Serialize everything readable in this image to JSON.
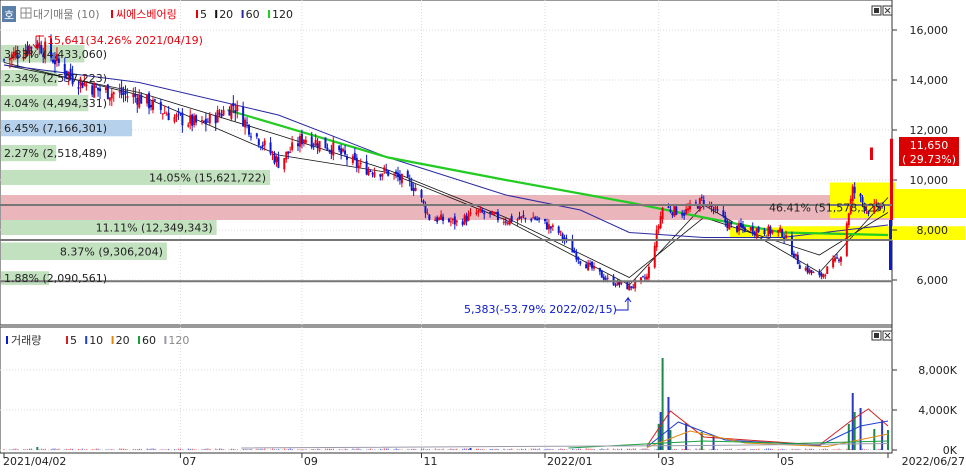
{
  "colors": {
    "up": "#e8000c",
    "down": "#0a1acc",
    "ma5": "#111111",
    "ma20": "#111111",
    "ma60": "#2a2aa0",
    "ma120": "#22cc22",
    "vol5": "#d22020",
    "vol10": "#2040d0",
    "vol20": "#e08a10",
    "vol60": "#18a040",
    "vol120": "#9a9aa8",
    "price_box": "#d80000",
    "highlight": "#ffff00",
    "band_pink": "#e7a8b0",
    "band_green": "#b7ddb4",
    "band_blue": "#a9c9e8"
  },
  "header": {
    "icon": "grid-icon",
    "label_stock_type": "대기매물",
    "label_stock_type_count": "(10)",
    "stock_name": "씨에스베어링",
    "ma_legend": [
      {
        "label": "5",
        "color": "#e8000c"
      },
      {
        "label": "20",
        "color": "#111111"
      },
      {
        "label": "60",
        "color": "#2a2aa0"
      },
      {
        "label": "120",
        "color": "#22cc22"
      }
    ],
    "window_buttons": [
      "restore-icon",
      "close-icon"
    ]
  },
  "side_tab": "호",
  "volume_header": {
    "title": "거래량",
    "legend": [
      {
        "label": "5",
        "color": "#d22020"
      },
      {
        "label": "10",
        "color": "#2040d0"
      },
      {
        "label": "20",
        "color": "#e08a10"
      },
      {
        "label": "60",
        "color": "#18a040"
      },
      {
        "label": "120",
        "color": "#9a9aa8"
      }
    ]
  },
  "annotations": {
    "high": "15,641(34.26% 2021/04/19)",
    "low": "5,383(-53.79% 2022/02/15)",
    "current_price": "11,650",
    "current_change": "( 29.73%)"
  },
  "chart_data": [
    {
      "type": "candlestick",
      "title": "씨에스베어링",
      "x_start": "2021/04/02",
      "x_end": "2022/06/27",
      "x_ticks": [
        "2021/04/02",
        "07",
        "09",
        "11",
        "2022/01",
        "03",
        "05",
        "2022/06/27"
      ],
      "y_ticks": [
        6000,
        8000,
        10000,
        12000,
        14000,
        16000
      ],
      "y_tick_labels": [
        "6,000",
        "8,000",
        "10,000",
        "12,000",
        "14,000",
        "16,000"
      ],
      "ylim": [
        4200,
        17200
      ],
      "high": {
        "price": 15641,
        "pct": 34.26,
        "date": "2021/04/19"
      },
      "low": {
        "price": 5383,
        "pct": -53.79,
        "date": "2022/02/15"
      },
      "last": {
        "price": 11650,
        "change_pct": 29.73
      },
      "close_path": [
        [
          "2021/04/02",
          14800
        ],
        [
          "2021/04/19",
          15500
        ],
        [
          "2021/05/07",
          14100
        ],
        [
          "2021/05/20",
          13600
        ],
        [
          "2021/06/10",
          13300
        ],
        [
          "2021/06/28",
          12500
        ],
        [
          "2021/07/12",
          12200
        ],
        [
          "2021/07/28",
          13000
        ],
        [
          "2021/08/06",
          12000
        ],
        [
          "2021/08/20",
          10700
        ],
        [
          "2021/09/02",
          11700
        ],
        [
          "2021/09/16",
          11300
        ],
        [
          "2021/10/01",
          10500
        ],
        [
          "2021/10/15",
          10300
        ],
        [
          "2021/10/29",
          9700
        ],
        [
          "2021/11/05",
          8500
        ],
        [
          "2021/11/19",
          8300
        ],
        [
          "2021/11/30",
          8700
        ],
        [
          "2021/12/14",
          8400
        ],
        [
          "2021/12/28",
          8500
        ],
        [
          "2022/01/10",
          7900
        ],
        [
          "2022/01/21",
          6800
        ],
        [
          "2022/02/04",
          6000
        ],
        [
          "2022/02/15",
          5700
        ],
        [
          "2022/02/24",
          6100
        ],
        [
          "2022/03/04",
          8900
        ],
        [
          "2022/03/15",
          8700
        ],
        [
          "2022/03/25",
          9200
        ],
        [
          "2022/04/08",
          8100
        ],
        [
          "2022/04/22",
          8000
        ],
        [
          "2022/05/04",
          7900
        ],
        [
          "2022/05/13",
          6600
        ],
        [
          "2022/05/23",
          6100
        ],
        [
          "2022/06/03",
          7000
        ],
        [
          "2022/06/09",
          9600
        ],
        [
          "2022/06/17",
          8800
        ],
        [
          "2022/06/24",
          9000
        ],
        [
          "2022/06/27",
          11650
        ]
      ],
      "ma_lines": [
        {
          "name": "5",
          "points": [
            [
              "2021/04/02",
              14700
            ],
            [
              "2021/06/10",
              13400
            ],
            [
              "2021/08/20",
              11000
            ],
            [
              "2021/10/15",
              10300
            ],
            [
              "2021/12/14",
              8400
            ],
            [
              "2022/02/15",
              5800
            ],
            [
              "2022/03/25",
              9000
            ],
            [
              "2022/05/23",
              6300
            ],
            [
              "2022/06/27",
              9300
            ]
          ]
        },
        {
          "name": "20",
          "points": [
            [
              "2021/04/02",
              14600
            ],
            [
              "2021/06/10",
              13500
            ],
            [
              "2021/08/20",
              11800
            ],
            [
              "2021/10/15",
              10400
            ],
            [
              "2021/12/14",
              8500
            ],
            [
              "2022/02/15",
              6100
            ],
            [
              "2022/03/25",
              8500
            ],
            [
              "2022/05/23",
              7000
            ],
            [
              "2022/06/27",
              8700
            ]
          ]
        },
        {
          "name": "60",
          "points": [
            [
              "2021/04/02",
              14600
            ],
            [
              "2021/06/10",
              13900
            ],
            [
              "2021/08/20",
              12600
            ],
            [
              "2021/10/15",
              10900
            ],
            [
              "2021/12/14",
              9400
            ],
            [
              "2022/01/21",
              8800
            ],
            [
              "2022/02/15",
              7900
            ],
            [
              "2022/03/25",
              7700
            ],
            [
              "2022/05/04",
              7700
            ],
            [
              "2022/06/27",
              8200
            ]
          ]
        },
        {
          "name": "120",
          "points": [
            [
              "2021/07/25",
              12800
            ],
            [
              "2021/10/15",
              10900
            ],
            [
              "2021/12/14",
              10000
            ],
            [
              "2022/02/15",
              9100
            ],
            [
              "2022/03/25",
              8500
            ],
            [
              "2022/05/04",
              7900
            ],
            [
              "2022/06/27",
              7800
            ]
          ]
        }
      ]
    },
    {
      "type": "table",
      "title": "대기매물",
      "bands": [
        {
          "label": "3.83% (4,433,060)",
          "pct": 3.83,
          "volume": 4433060,
          "price_low": 14700,
          "price_high": 15400,
          "color": "#b7ddb4"
        },
        {
          "label": "2.34% (2,597,223)",
          "pct": 2.34,
          "volume": 2597223,
          "price_low": 13750,
          "price_high": 14400,
          "color": "#b7ddb4"
        },
        {
          "label": "4.04% (4,494,331)",
          "pct": 4.04,
          "volume": 4494331,
          "price_low": 12750,
          "price_high": 13400,
          "color": "#b7ddb4"
        },
        {
          "label": "6.45% (7,166,301)",
          "pct": 6.45,
          "volume": 7166301,
          "price_low": 11750,
          "price_high": 12400,
          "color": "#a9c9e8"
        },
        {
          "label": "2.27% (2,518,489)",
          "pct": 2.27,
          "volume": 2518489,
          "price_low": 10750,
          "price_high": 11400,
          "color": "#b7ddb4"
        },
        {
          "label": "14.05% (15,621,722)",
          "pct": 14.05,
          "volume": 15621722,
          "price_low": 9800,
          "price_high": 10400,
          "color": "#b7ddb4"
        },
        {
          "label": "46.41% (51,578,525)",
          "pct": 46.41,
          "volume": 51578525,
          "price_low": 8400,
          "price_high": 9400,
          "color": "#e7a8b0"
        },
        {
          "label": "11.11% (12,349,343)",
          "pct": 11.11,
          "volume": 12349343,
          "price_low": 7800,
          "price_high": 8400,
          "color": "#b7ddb4"
        },
        {
          "label": "8.37% (9,306,204)",
          "pct": 8.37,
          "volume": 9306204,
          "price_low": 6800,
          "price_high": 7500,
          "color": "#b7ddb4"
        },
        {
          "label": "1.88% (2,090,561)",
          "pct": 1.88,
          "volume": 2090561,
          "price_low": 5800,
          "price_high": 6350,
          "color": "#b7ddb4"
        }
      ],
      "price_lines": [
        9000,
        7600,
        5950
      ]
    },
    {
      "type": "bar",
      "title": "거래량",
      "y_ticks": [
        "0K",
        "4,000K",
        "8,000K"
      ],
      "ylim": [
        0,
        10000
      ],
      "volume_spikes": [
        {
          "date": "2021/04/19",
          "value": 300
        },
        {
          "date": "2021/11/26",
          "value": 200
        },
        {
          "date": "2022/03/02",
          "value": 2600
        },
        {
          "date": "2022/03/03",
          "value": 3800
        },
        {
          "date": "2022/03/04",
          "value": 9200
        },
        {
          "date": "2022/03/07",
          "value": 5300
        },
        {
          "date": "2022/03/08",
          "value": 2000
        },
        {
          "date": "2022/03/16",
          "value": 2700
        },
        {
          "date": "2022/03/24",
          "value": 1800
        },
        {
          "date": "2022/03/30",
          "value": 1400
        },
        {
          "date": "2022/06/07",
          "value": 2600
        },
        {
          "date": "2022/06/09",
          "value": 5700
        },
        {
          "date": "2022/06/10",
          "value": 3800
        },
        {
          "date": "2022/06/13",
          "value": 4200
        },
        {
          "date": "2022/06/20",
          "value": 2100
        },
        {
          "date": "2022/06/24",
          "value": 3000
        },
        {
          "date": "2022/06/27",
          "value": 2000
        }
      ],
      "ma_lines": [
        {
          "name": "5",
          "points": [
            [
              "2022/02/24",
              400
            ],
            [
              "2022/03/08",
              3900
            ],
            [
              "2022/03/25",
              1300
            ],
            [
              "2022/05/23",
              500
            ],
            [
              "2022/06/10",
              3200
            ],
            [
              "2022/06/17",
              4100
            ],
            [
              "2022/06/27",
              2400
            ]
          ]
        },
        {
          "name": "10",
          "points": [
            [
              "2022/02/24",
              300
            ],
            [
              "2022/03/12",
              2800
            ],
            [
              "2022/04/05",
              1000
            ],
            [
              "2022/05/23",
              450
            ],
            [
              "2022/06/13",
              2400
            ],
            [
              "2022/06/27",
              2900
            ]
          ]
        },
        {
          "name": "20",
          "points": [
            [
              "2022/02/24",
              250
            ],
            [
              "2022/03/18",
              1900
            ],
            [
              "2022/04/15",
              700
            ],
            [
              "2022/05/27",
              350
            ],
            [
              "2022/06/27",
              1600
            ]
          ]
        },
        {
          "name": "60",
          "points": [
            [
              "2022/01/15",
              200
            ],
            [
              "2022/03/25",
              900
            ],
            [
              "2022/05/10",
              650
            ],
            [
              "2022/06/27",
              900
            ]
          ]
        },
        {
          "name": "120",
          "points": [
            [
              "2021/08/01",
              200
            ],
            [
              "2022/03/25",
              450
            ],
            [
              "2022/06/27",
              650
            ]
          ]
        }
      ]
    }
  ]
}
